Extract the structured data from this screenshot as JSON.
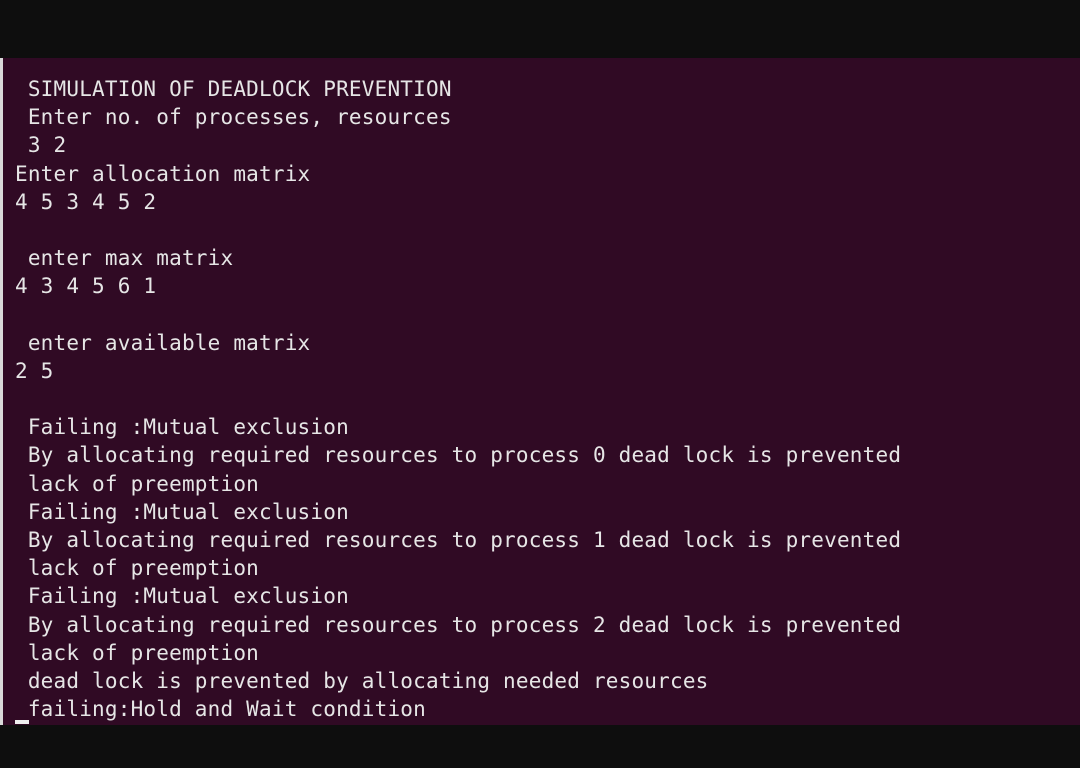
{
  "terminal": {
    "lines": [
      {
        "text": " SIMULATION OF DEADLOCK PREVENTION"
      },
      {
        "text": " Enter no. of processes, resources"
      },
      {
        "text": " 3 2"
      },
      {
        "text": "Enter allocation matrix"
      },
      {
        "text": "4 5 3 4 5 2"
      },
      {
        "text": ""
      },
      {
        "text": " enter max matrix"
      },
      {
        "text": "4 3 4 5 6 1"
      },
      {
        "text": ""
      },
      {
        "text": " enter available matrix"
      },
      {
        "text": "2 5"
      },
      {
        "text": ""
      },
      {
        "text": " Failing :Mutual exclusion"
      },
      {
        "text": " By allocating required resources to process 0 dead lock is prevented"
      },
      {
        "text": " lack of preemption"
      },
      {
        "text": " Failing :Mutual exclusion"
      },
      {
        "text": " By allocating required resources to process 1 dead lock is prevented"
      },
      {
        "text": " lack of preemption"
      },
      {
        "text": " Failing :Mutual exclusion"
      },
      {
        "text": " By allocating required resources to process 2 dead lock is prevented"
      },
      {
        "text": " lack of preemption"
      },
      {
        "text": " dead lock is prevented by allocating needed resources"
      },
      {
        "text": " failing:Hold and Wait condition"
      }
    ]
  },
  "colors": {
    "terminal_background": "#300a24",
    "text": "#e6e6e6",
    "outer_background": "#0e0e0e"
  }
}
